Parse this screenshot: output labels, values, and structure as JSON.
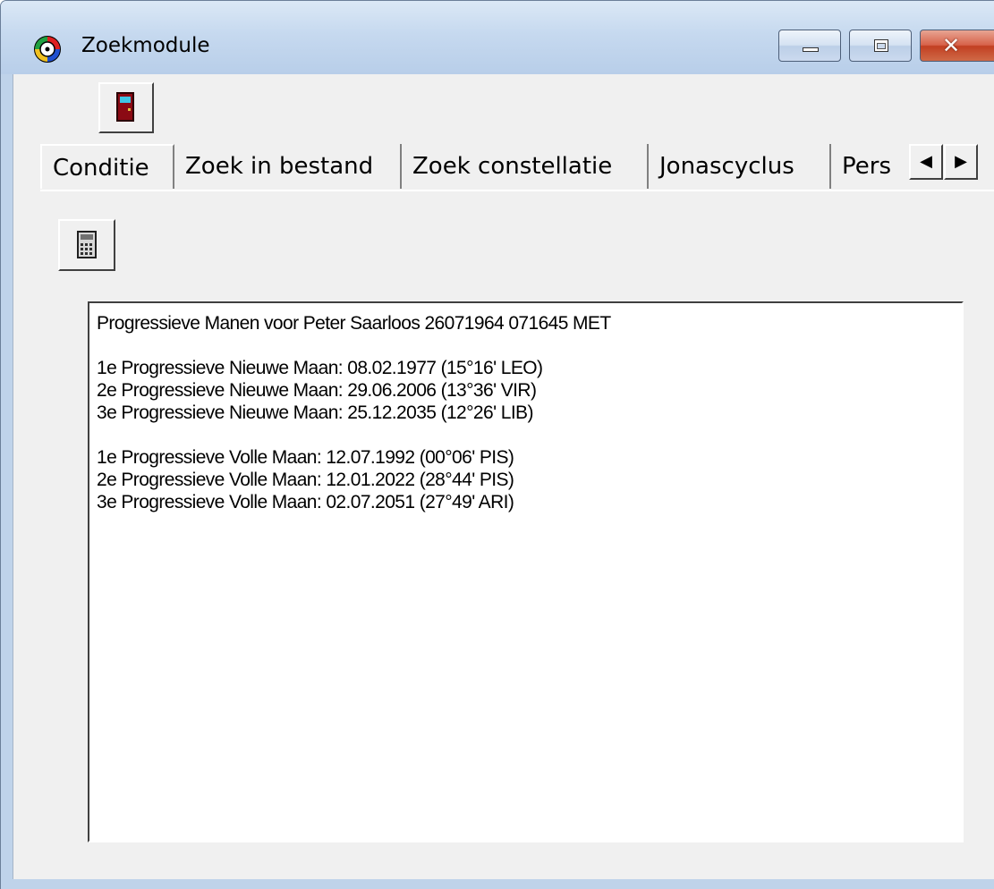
{
  "window": {
    "title": "Zoekmodule",
    "close_glyph": "✕"
  },
  "tabs": [
    {
      "label": "Conditie",
      "active": true
    },
    {
      "label": "Zoek in bestand",
      "active": false
    },
    {
      "label": "Zoek constellatie",
      "active": false
    },
    {
      "label": "Jonascyclus",
      "active": false
    },
    {
      "label": "Pers",
      "active": false
    }
  ],
  "tab_scroll": {
    "left_glyph": "◀",
    "right_glyph": "▶"
  },
  "result": {
    "header": "Progressieve Manen voor Peter Saarloos 26071964 071645 MET",
    "new_moons": [
      "1e Progressieve Nieuwe Maan: 08.02.1977  (15°16' LEO)",
      "2e Progressieve Nieuwe Maan: 29.06.2006  (13°36' VIR)",
      "3e Progressieve Nieuwe Maan: 25.12.2035  (12°26' LIB)"
    ],
    "full_moons": [
      "1e Progressieve Volle Maan: 12.07.1992 (00°06' PIS)",
      "2e Progressieve Volle Maan: 12.01.2022 (28°44' PIS)",
      "3e Progressieve Volle Maan: 02.07.2051 (27°49' ARI)"
    ]
  },
  "icons": {
    "app": "astrology-wheel-icon",
    "toolbar_exit": "door-exit-icon",
    "calculate": "calculator-icon"
  },
  "colors": {
    "titlebar": "#c6d9ef",
    "close_button": "#c94a2c",
    "door": "#8b0a14",
    "face": "#f0f0f0"
  }
}
